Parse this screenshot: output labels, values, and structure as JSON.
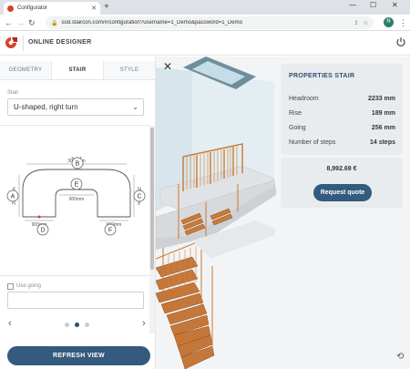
{
  "browser": {
    "tab_title": "Configurator",
    "url": "sod.staircon.com/#/configuration?username=1_Demo&password=1_Demo",
    "profile_initial": "R"
  },
  "app": {
    "title": "ONLINE DESIGNER",
    "brand_color": "#d9402a",
    "accent_color": "#345a7d"
  },
  "left_panel": {
    "tabs": [
      "GEOMETRY",
      "STAIR",
      "STYLE"
    ],
    "active_tab": "STAIR",
    "stair_label": "Stair",
    "stair_type": "U-shaped, right turn",
    "diagram": {
      "points": [
        "A",
        "B",
        "C",
        "D",
        "E",
        "F"
      ],
      "dim_top": "3000mm",
      "dim_inner": "900mm",
      "dim_left": "2500mm",
      "dim_right": "2500mm",
      "dim_bottom_left": "900mm",
      "dim_bottom_right": "900mm"
    },
    "use_going_label": "Use going",
    "going_value": "",
    "pager": {
      "pages": 3,
      "current": 2
    },
    "refresh_label": "REFRESH VIEW"
  },
  "properties": {
    "title": "PROPERTIES STAIR",
    "rows": [
      {
        "label": "Headroom",
        "value": "2233 mm"
      },
      {
        "label": "Rise",
        "value": "189 mm"
      },
      {
        "label": "Going",
        "value": "256 mm"
      },
      {
        "label": "Number of steps",
        "value": "14 steps"
      }
    ]
  },
  "price": {
    "amount": "8,992.69 €",
    "request_label": "Request quote"
  },
  "icons": {
    "close": "close-icon",
    "history": "history-icon",
    "power": "power-icon"
  }
}
